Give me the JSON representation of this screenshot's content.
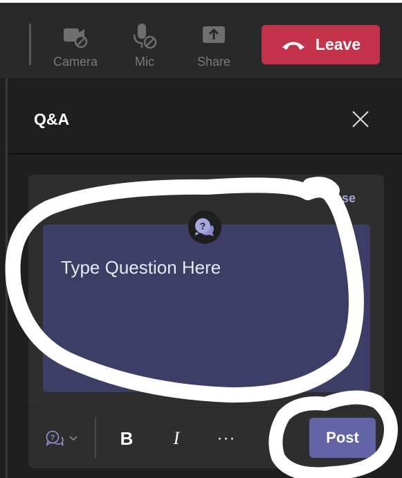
{
  "meeting_toolbar": {
    "camera_label": "Camera",
    "mic_label": "Mic",
    "share_label": "Share",
    "leave_label": "Leave",
    "icons": [
      "camera-off-icon",
      "mic-off-icon",
      "share-icon",
      "hang-up-icon"
    ]
  },
  "qa_panel": {
    "title": "Q&A",
    "close_icon": "close-icon",
    "card": {
      "close_link_partial": "ose",
      "question_icon": "question-bubble-icon",
      "editor_text": "Type Question Here"
    },
    "format_toolbar": {
      "type_icon": "question-bubble-icon",
      "bold_label": "B",
      "italic_label": "I",
      "more_label": "···",
      "post_label": "Post"
    }
  },
  "colors": {
    "leave_red": "#c4314b",
    "post_purple": "#6264a7",
    "editor_bg": "#3d3e66",
    "accent_link": "#a6a7dc"
  }
}
